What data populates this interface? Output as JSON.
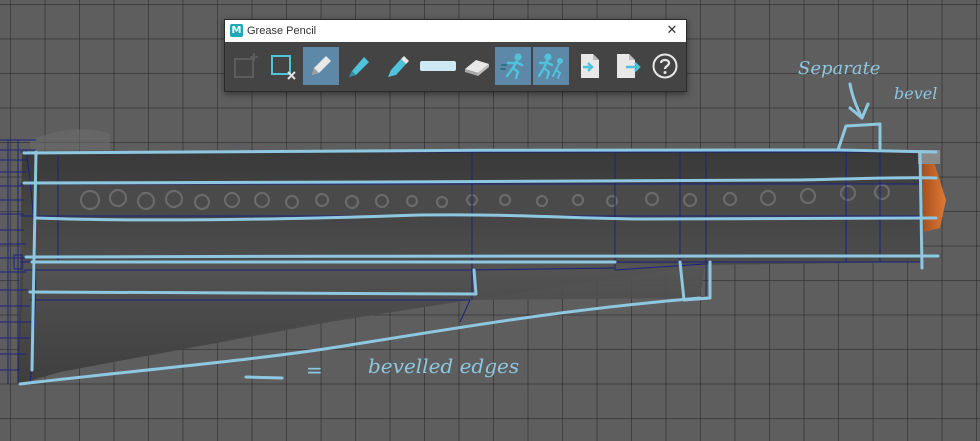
{
  "window": {
    "title": "Grease Pencil",
    "logo_letter": "M",
    "close_glyph": "✕"
  },
  "toolbar": {
    "tools": [
      {
        "icon": "add-frame-icon",
        "state": "disabled"
      },
      {
        "icon": "delete-frame-icon",
        "state": "normal"
      },
      {
        "icon": "pencil-icon",
        "state": "active"
      },
      {
        "icon": "marker-icon",
        "state": "normal"
      },
      {
        "icon": "soft-pencil-icon",
        "state": "normal"
      },
      {
        "icon": "brush-stroke-icon",
        "state": "normal"
      },
      {
        "icon": "eraser-icon",
        "state": "normal"
      },
      {
        "icon": "ghost-previous-icon",
        "state": "active"
      },
      {
        "icon": "ghost-next-icon",
        "state": "active"
      },
      {
        "icon": "import-icon",
        "state": "normal"
      },
      {
        "icon": "export-icon",
        "state": "normal"
      },
      {
        "icon": "help-icon",
        "state": "normal"
      }
    ]
  },
  "annotations": {
    "note_1_line_1": "Separate",
    "note_1_line_2": "bevel",
    "legend_note": "bevelled edges",
    "legend_equals": "="
  },
  "colors": {
    "viewport_bg": "#5e5e5e",
    "sketch_blue": "#8ec7e0",
    "mesh_wire": "#1a237e",
    "active_tool": "#5d88a8",
    "panel_bg": "#444444",
    "orange_tip": "#d9712f"
  }
}
